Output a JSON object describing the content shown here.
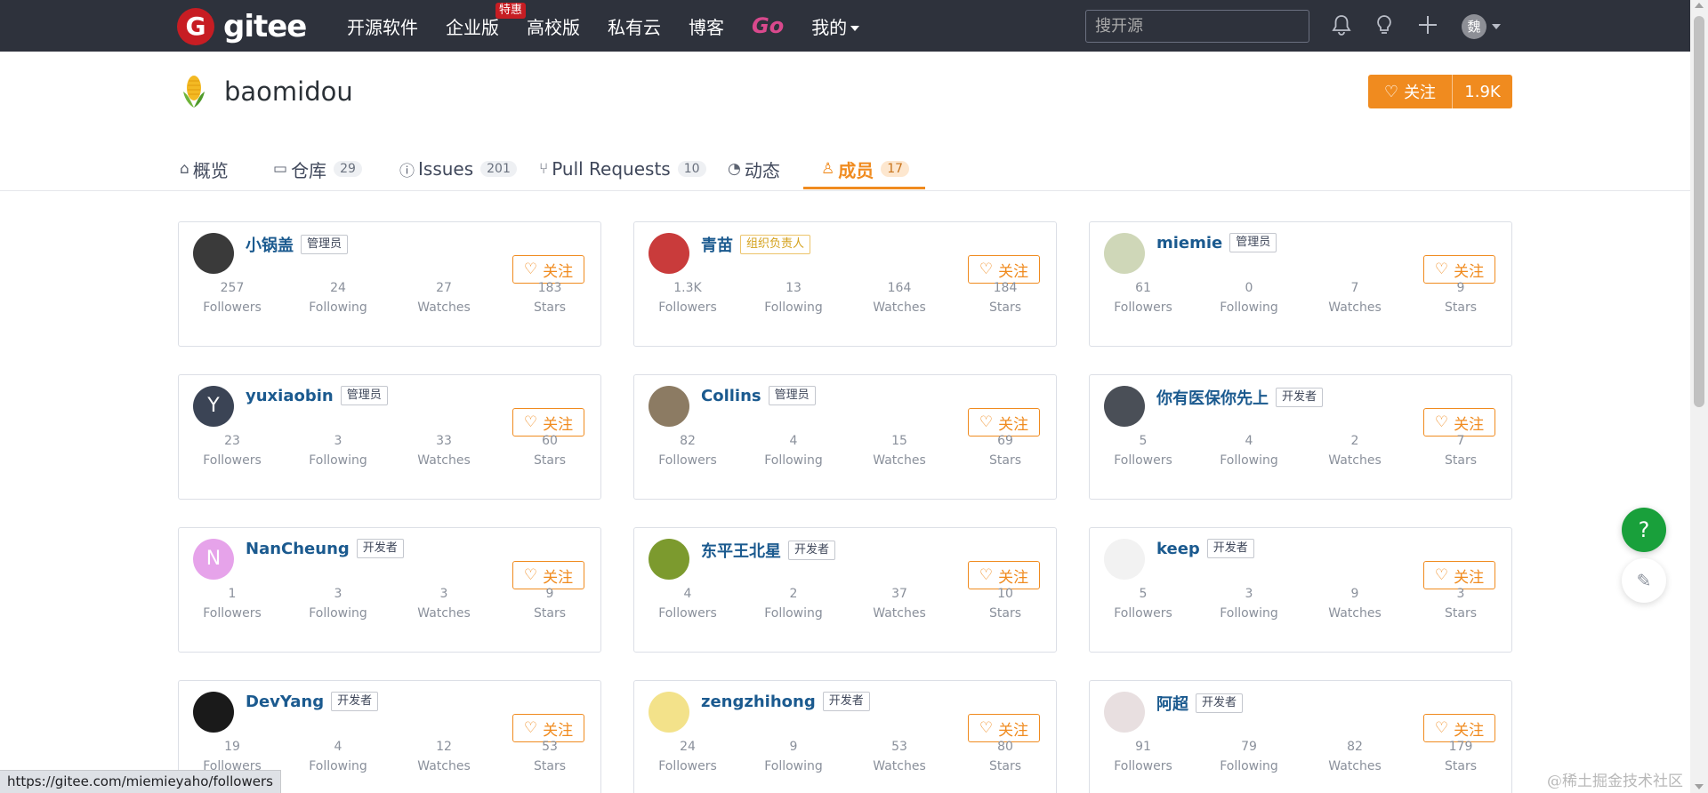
{
  "navbar": {
    "logo_letter": "G",
    "logo_text": "gitee",
    "items": [
      {
        "label": "开源软件"
      },
      {
        "label": "企业版",
        "badge": "特惠"
      },
      {
        "label": "高校版"
      },
      {
        "label": "私有云"
      },
      {
        "label": "博客"
      },
      {
        "label": "Go"
      },
      {
        "label": "我的"
      }
    ],
    "search_placeholder": "搜开源",
    "user_initial": "魏"
  },
  "org": {
    "name": "baomidou",
    "follow_label": "关注",
    "follower_count": "1.9K"
  },
  "tabs": [
    {
      "label": "概览",
      "count": ""
    },
    {
      "label": "仓库",
      "count": "29"
    },
    {
      "label": "Issues",
      "count": "201"
    },
    {
      "label": "Pull Requests",
      "count": "10"
    },
    {
      "label": "动态",
      "count": ""
    },
    {
      "label": "成员",
      "count": "17"
    }
  ],
  "stat_labels": [
    "Followers",
    "Following",
    "Watches",
    "Stars"
  ],
  "follow_button_label": "关注",
  "members": [
    {
      "name": "小锅盖",
      "role": "管理员",
      "avatar_color": "#3a3a3a",
      "avatar_text": "",
      "stats": [
        "257",
        "24",
        "27",
        "183"
      ]
    },
    {
      "name": "青苗",
      "role": "组织负责人",
      "role_lead": true,
      "avatar_color": "#c93b3b",
      "avatar_text": "",
      "stats": [
        "1.3K",
        "13",
        "164",
        "184"
      ]
    },
    {
      "name": "miemie",
      "role": "管理员",
      "avatar_color": "#cfd7b8",
      "avatar_text": "",
      "stats": [
        "61",
        "0",
        "7",
        "9"
      ]
    },
    {
      "name": "yuxiaobin",
      "role": "管理员",
      "avatar_color": "#3b4455",
      "avatar_text": "Y",
      "stats": [
        "23",
        "3",
        "33",
        "60"
      ]
    },
    {
      "name": "Collins",
      "role": "管理员",
      "avatar_color": "#8c7b63",
      "avatar_text": "",
      "stats": [
        "82",
        "4",
        "15",
        "69"
      ]
    },
    {
      "name": "你有医保你先上",
      "role": "开发者",
      "avatar_color": "#4a4f57",
      "avatar_text": "",
      "stats": [
        "5",
        "4",
        "2",
        "7"
      ]
    },
    {
      "name": "NanCheung",
      "role": "开发者",
      "avatar_color": "#e6a3ea",
      "avatar_text": "N",
      "stats": [
        "1",
        "3",
        "3",
        "9"
      ]
    },
    {
      "name": "东平王北星",
      "role": "开发者",
      "avatar_color": "#7c9a2e",
      "avatar_text": "",
      "stats": [
        "4",
        "2",
        "37",
        "10"
      ]
    },
    {
      "name": "keep",
      "role": "开发者",
      "avatar_color": "#f2f2f2",
      "avatar_text": "",
      "stats": [
        "5",
        "3",
        "9",
        "3"
      ]
    },
    {
      "name": "DevYang",
      "role": "开发者",
      "avatar_color": "#1a1a1a",
      "avatar_text": "",
      "stats": [
        "19",
        "4",
        "12",
        "53"
      ]
    },
    {
      "name": "zengzhihong",
      "role": "开发者",
      "avatar_color": "#f3e28a",
      "avatar_text": "",
      "stats": [
        "24",
        "9",
        "53",
        "80"
      ]
    },
    {
      "name": "阿超",
      "role": "开发者",
      "avatar_color": "#e8dfe0",
      "avatar_text": "",
      "stats": [
        "91",
        "79",
        "82",
        "179"
      ]
    }
  ],
  "floating": {
    "help": "?",
    "feedback": "✎"
  },
  "status_url": "https://gitee.com/miemieyaho/followers",
  "watermark": "@稀土掘金技术社区",
  "colors": {
    "accent": "#f08b1f",
    "navbar": "#2e323c",
    "brand_red": "#c71d23",
    "help_green": "#19a03b"
  }
}
